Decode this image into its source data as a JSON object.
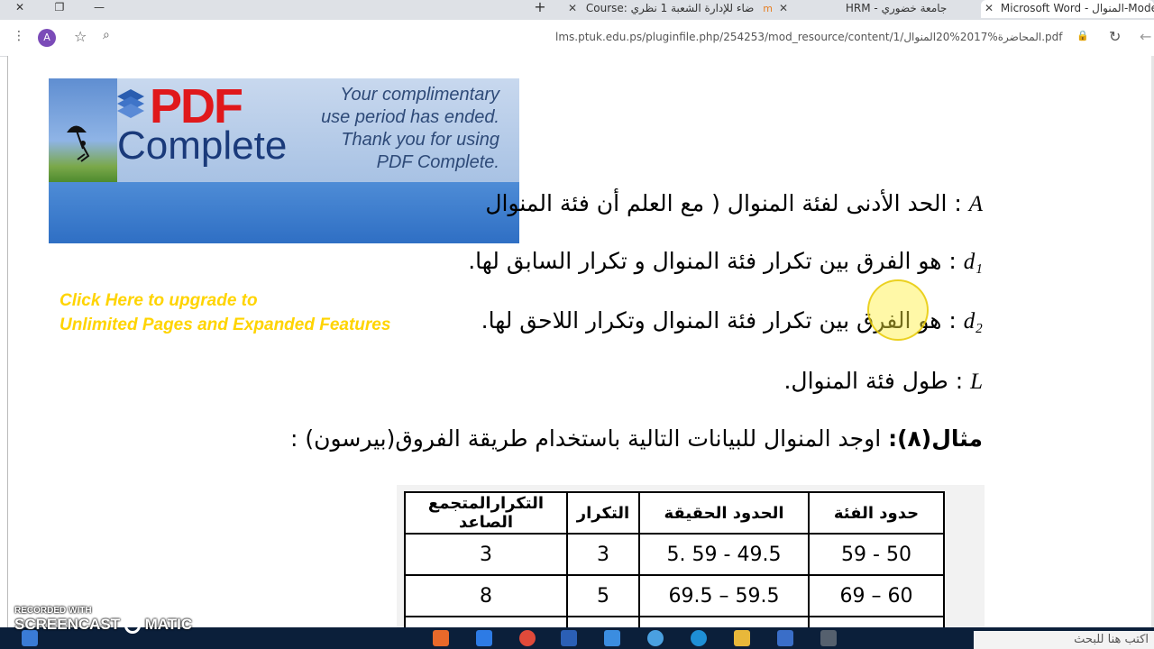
{
  "browser": {
    "tabs": [
      {
        "title": "Microsoft Word - المنوال-Mode",
        "active": true
      },
      {
        "title": "HRM - جامعة خضوري"
      },
      {
        "title": "Course: ضاء للإدارة الشعبة 1 نظري"
      }
    ],
    "url": "lms.ptuk.edu.ps/pluginfile.php/254253/mod_resource/content/1/المحاضرة%2017%20المنوال.pdf",
    "avatar_letter": "A"
  },
  "banner": {
    "brand_pdf": "PDF",
    "brand_complete": "Complete",
    "promo_lines": [
      "Your complimentary",
      "use period has ended.",
      "Thank you for using",
      "PDF Complete."
    ],
    "upgrade_line1": "Click Here to upgrade to",
    "upgrade_line2": "Unlimited Pages and Expanded Features"
  },
  "definitions": [
    {
      "symbol": "A",
      "text": ": الحد الأدنى لفئة المنوال ( مع العلم أن فئة المنوال"
    },
    {
      "symbol": "d₁",
      "text": ": هو الفرق بين تكرار فئة المنوال و تكرار السابق لها."
    },
    {
      "symbol": "d₂",
      "text": ": هو الفرق بين تكرار فئة المنوال وتكرار اللاحق لها."
    },
    {
      "symbol": "L",
      "text": ": طول فئة المنوال."
    }
  ],
  "example": {
    "label": "مثال(٨):",
    "text": " اوجد المنوال للبيانات التالية باستخدام طريقة الفروق(بيرسون) :"
  },
  "table": {
    "headers": [
      "حدود الفئة",
      "الحدود الحقيقة",
      "التكرار",
      "التكرارالمتجمع الصاعد"
    ],
    "rows": [
      [
        "50 - 59",
        "49.5 - 59 .5",
        "3",
        "3"
      ],
      [
        "60 – 69",
        "59.5 – 69.5",
        "5",
        "8"
      ]
    ]
  },
  "taskbar": {
    "search_placeholder": "اكتب هنا للبحث"
  },
  "watermark": {
    "line1": "RECORDED WITH",
    "line2": "SCREENCAST",
    "line3": "MATIC"
  }
}
